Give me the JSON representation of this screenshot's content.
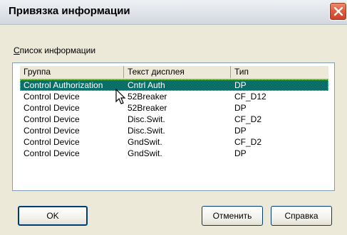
{
  "window": {
    "title": "Привязка информации"
  },
  "list": {
    "label_prefix": "С",
    "label_rest": "писок информации",
    "columns": [
      "Группа",
      "Текст дисплея",
      "Тип"
    ],
    "rows": [
      [
        "Control Authorization",
        "Cntrl Auth",
        "DP"
      ],
      [
        "Control Device",
        "52Breaker",
        "CF_D12"
      ],
      [
        "Control Device",
        "52Breaker",
        "DP"
      ],
      [
        "Control Device",
        "Disc.Swit.",
        "CF_D2"
      ],
      [
        "Control Device",
        "Disc.Swit.",
        "DP"
      ],
      [
        "Control Device",
        "GndSwit.",
        "CF_D2"
      ],
      [
        "Control Device",
        "GndSwit.",
        "DP"
      ]
    ],
    "selected_index": 0
  },
  "buttons": {
    "ok": "OK",
    "cancel": "Отменить",
    "help": "Справка"
  },
  "colors": {
    "selection": "#0a6f68",
    "close_button": "#e05a3c"
  }
}
